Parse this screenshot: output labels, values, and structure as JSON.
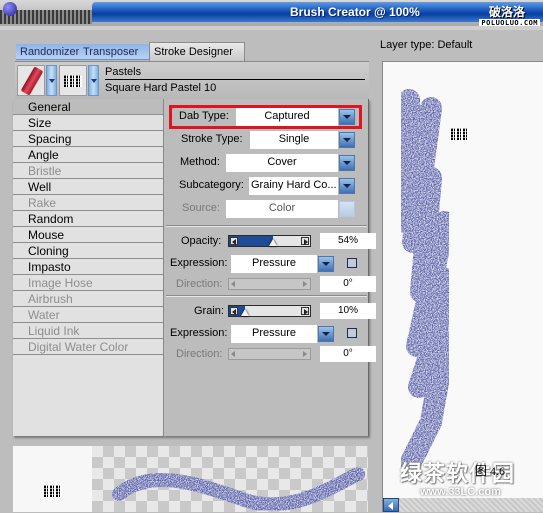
{
  "window": {
    "title": "Brush Creator @ 100%",
    "watermark_top": "破洛洛",
    "watermark_top_sub": "POLUOLUO.COM"
  },
  "tabs": [
    {
      "label": "Randomizer",
      "active": false
    },
    {
      "label": "Transposer",
      "active": false
    },
    {
      "label": "Stroke Designer",
      "active": true
    }
  ],
  "brush": {
    "category_icon": "pastel-stick-icon",
    "category": "Pastels",
    "variant_icon": "captured-dab-icon",
    "variant": "Square Hard Pastel 10"
  },
  "categories": [
    {
      "label": "General",
      "selected": true,
      "enabled": true
    },
    {
      "label": "Size",
      "enabled": true
    },
    {
      "label": "Spacing",
      "enabled": true
    },
    {
      "label": "Angle",
      "enabled": true
    },
    {
      "label": "Bristle",
      "enabled": false
    },
    {
      "label": "Well",
      "enabled": true
    },
    {
      "label": "Rake",
      "enabled": false
    },
    {
      "label": "Random",
      "enabled": true
    },
    {
      "label": "Mouse",
      "enabled": true
    },
    {
      "label": "Cloning",
      "enabled": true
    },
    {
      "label": "Impasto",
      "enabled": true
    },
    {
      "label": "Image Hose",
      "enabled": false
    },
    {
      "label": "Airbrush",
      "enabled": false
    },
    {
      "label": "Water",
      "enabled": false
    },
    {
      "label": "Liquid Ink",
      "enabled": false
    },
    {
      "label": "Digital Water Color",
      "enabled": false
    }
  ],
  "general": {
    "dab_type": {
      "label": "Dab Type:",
      "value": "Captured",
      "highlighted": true
    },
    "stroke_type": {
      "label": "Stroke Type:",
      "value": "Single"
    },
    "method": {
      "label": "Method:",
      "value": "Cover"
    },
    "subcategory": {
      "label": "Subcategory:",
      "value": "Grainy Hard Co..."
    },
    "source": {
      "label": "Source:",
      "value": "Color",
      "enabled": false
    },
    "opacity": {
      "label": "Opacity:",
      "value_text": "54%",
      "value": 54,
      "expression": {
        "label": "Expression:",
        "value": "Pressure",
        "inverted": false
      },
      "direction": {
        "label": "Direction:",
        "value_text": "0°",
        "enabled": false
      }
    },
    "grain": {
      "label": "Grain:",
      "value_text": "10%",
      "value": 10,
      "expression": {
        "label": "Expression:",
        "value": "Pressure",
        "inverted": false
      },
      "direction": {
        "label": "Direction:",
        "value_text": "0°",
        "enabled": false
      }
    }
  },
  "preview": {
    "layer_type": "Layer type: Default",
    "stroke_color": "#5a62b0"
  },
  "watermark_bottom": {
    "logo": "绿茶软件园",
    "figure": "图 4.6",
    "url": "www.33LC.com"
  },
  "colors": {
    "accent_blue": "#1553b8",
    "highlight_red": "#e0141e",
    "slider_fill": "#1f4c96"
  }
}
